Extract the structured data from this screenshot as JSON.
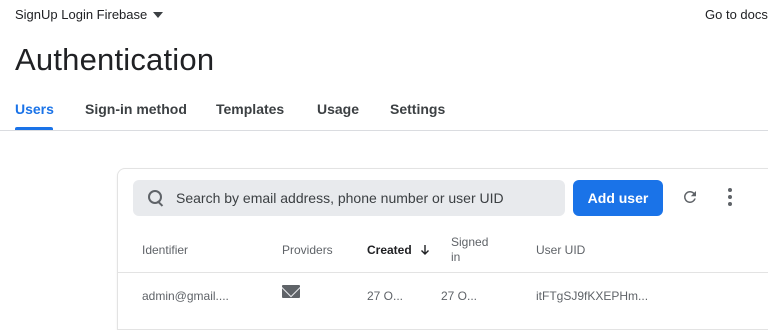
{
  "header": {
    "project_name": "SignUp Login Firebase",
    "docs_link": "Go to docs"
  },
  "page": {
    "title": "Authentication"
  },
  "tabs": [
    {
      "label": "Users",
      "active": true
    },
    {
      "label": "Sign-in method",
      "active": false
    },
    {
      "label": "Templates",
      "active": false
    },
    {
      "label": "Usage",
      "active": false
    },
    {
      "label": "Settings",
      "active": false
    }
  ],
  "users_table": {
    "search_placeholder": "Search by email address, phone number or user UID",
    "add_user_label": "Add user",
    "columns": {
      "identifier": "Identifier",
      "providers": "Providers",
      "created": "Created",
      "signed_in_line1": "Signed",
      "signed_in_line2": "in",
      "user_uid": "User UID"
    },
    "rows": [
      {
        "identifier": "admin@gmail....",
        "provider_icon": "mail-icon",
        "created": "27 O...",
        "signed_in": "27 O...",
        "user_uid": "itFTgSJ9fKXEPHm..."
      }
    ]
  },
  "colors": {
    "accent": "#1a73e8",
    "text": "#202124",
    "muted": "#5f6368",
    "search_bg": "#e8eaed"
  }
}
